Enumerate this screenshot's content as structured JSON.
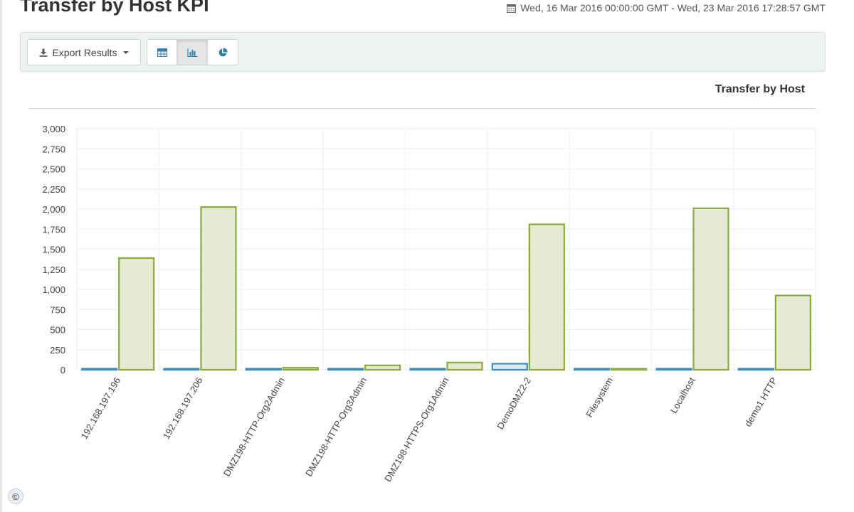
{
  "header": {
    "title": "Transfer by Host KPI",
    "date_range": "Wed, 16 Mar 2016 00:00:00 GMT - Wed, 23 Mar 2016 17:28:57 GMT"
  },
  "toolbar": {
    "export_label": "Export Results",
    "view_buttons": [
      "table-icon",
      "bar-chart-icon",
      "pie-chart-icon"
    ],
    "active_view": "bar-chart-icon"
  },
  "colors": {
    "series_blue_stroke": "#3a8dbf",
    "series_blue_fill": "#dbeaf2",
    "series_green_stroke": "#8aab3c",
    "series_green_fill": "#e6ead2"
  },
  "chart_data": {
    "type": "bar",
    "title": "Transfer by Host",
    "categories": [
      "192.168.197.196",
      "192.168.197.206",
      "DMZ198-HTTP-Org2Admin",
      "DMZ198-HTTP-Org3Admin",
      "DMZ198-HTTPS-Org1Admin",
      "DemoDMZ2-2",
      "Filesystem",
      "Localhost",
      "demo1 HTTP"
    ],
    "series": [
      {
        "values": [
          0,
          0,
          0,
          0,
          0,
          75,
          0,
          0,
          0
        ]
      },
      {
        "values": [
          1390,
          2025,
          25,
          55,
          90,
          1810,
          5,
          2010,
          925
        ]
      }
    ],
    "ylim": [
      0,
      3000
    ],
    "yticks": [
      "0",
      "250",
      "500",
      "750",
      "1,000",
      "1,250",
      "1,500",
      "1,750",
      "2,000",
      "2,250",
      "2,500",
      "2,750",
      "3,000"
    ],
    "grid": true,
    "xlabel": "",
    "ylabel": ""
  },
  "footer": {
    "copyright_symbol": "©"
  }
}
